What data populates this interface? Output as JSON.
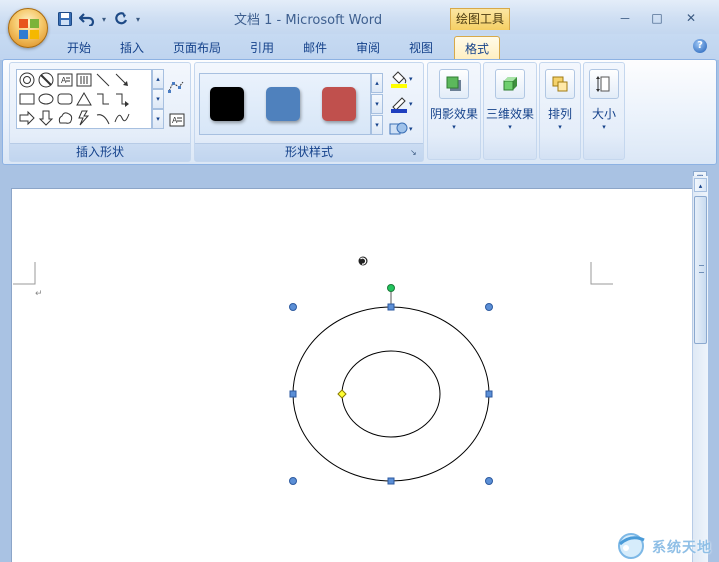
{
  "window": {
    "title": "文档 1 - Microsoft Word",
    "context_tab_group": "绘图工具",
    "controls": {
      "minimize": "－",
      "maximize": "□",
      "close": "✕"
    }
  },
  "qat": {
    "more": "▾"
  },
  "tabs": [
    {
      "label": "开始"
    },
    {
      "label": "插入"
    },
    {
      "label": "页面布局"
    },
    {
      "label": "引用"
    },
    {
      "label": "邮件"
    },
    {
      "label": "审阅"
    },
    {
      "label": "视图"
    },
    {
      "label": "格式",
      "active": true
    }
  ],
  "help": "?",
  "ribbon": {
    "insert_shapes": {
      "label": "插入形状",
      "more": "▾",
      "up": "▴",
      "down": "▾"
    },
    "shape_styles": {
      "label": "形状样式",
      "launcher": "↘",
      "swatches": [
        "#000000",
        "#4f81bd",
        "#c0504d"
      ]
    },
    "shadow_effects": {
      "label": "阴影效果",
      "arrow": "▾"
    },
    "3d_effects": {
      "label": "三维效果",
      "arrow": "▾"
    },
    "arrange": {
      "label": "排列",
      "arrow": "▾"
    },
    "size": {
      "label": "大小",
      "arrow": "▾"
    }
  },
  "document": {
    "paragraph_mark": "↵",
    "scroll_up": "▴",
    "ruler_toggle": "⊞"
  },
  "watermark": {
    "text": "系统天地"
  },
  "colors": {
    "ribbon_bg": "#dbe7f6",
    "context_tab": "#f5cf63",
    "rotation_handle": "#22c55e",
    "adjust_handle": "#ffff33",
    "selection_handle": "#5b8fd6"
  }
}
